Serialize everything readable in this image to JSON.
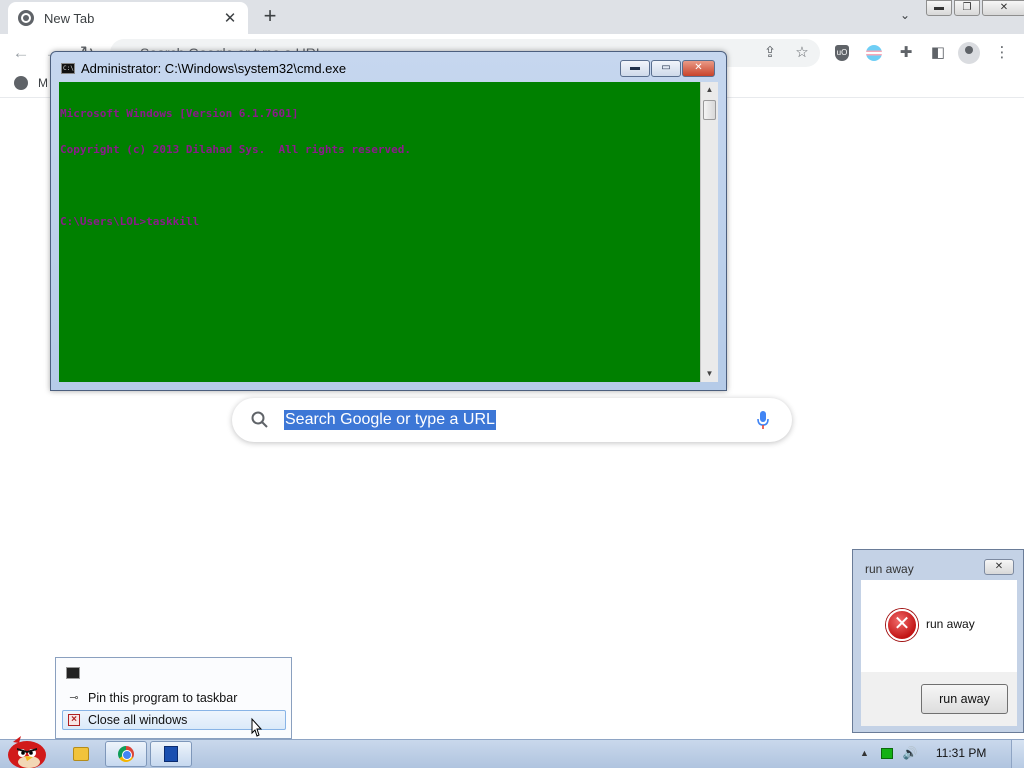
{
  "browser": {
    "tab": {
      "title": "New Tab",
      "close_symbol": "✕"
    },
    "new_tab_symbol": "+",
    "tab_search_symbol": "⌄",
    "window_controls": {
      "minimize": "▬",
      "restore": "❐",
      "close": "✕"
    },
    "nav": {
      "back": "←",
      "forward": "→",
      "reload": "↻"
    },
    "omnibox_placeholder": "Search Google or type a URL",
    "toolbar_icons": [
      "share-icon",
      "bookmark-star-icon",
      "ublock-icon",
      "flag-extension-icon",
      "extensions-puzzle-icon",
      "side-panel-icon",
      "profile-icon",
      "menu-kebab-icon"
    ],
    "bookmark_item": "M"
  },
  "ntp": {
    "search_text": "Search Google or type a URL"
  },
  "cmd": {
    "title": "Administrator: C:\\Windows\\system32\\cmd.exe",
    "controls": {
      "minimize": "▬",
      "maximize": "▭",
      "close": "✕"
    },
    "lines": [
      "Microsoft Windows [Version 6.1.7601]",
      "Copyright (c) 2013 Dilahad Sys.  All rights reserved.",
      "",
      "C:\\Users\\LOL>taskkill"
    ],
    "colors": {
      "background": "#008000",
      "text": "#8b1a8b"
    }
  },
  "jumplist": {
    "items": [
      {
        "label": "Pin this program to taskbar",
        "icon": "pin-icon"
      },
      {
        "label": "Close all windows",
        "icon": "close-window-icon"
      }
    ]
  },
  "dialog": {
    "title": "run away",
    "message": "run away",
    "button": "run away",
    "close_symbol": "✕"
  },
  "taskbar": {
    "apps": [
      "folder-icon",
      "chrome-icon",
      "cmd-icon"
    ],
    "tray": {
      "arrow": "▲",
      "volume": "🔊",
      "clock": "11:31 PM"
    }
  }
}
